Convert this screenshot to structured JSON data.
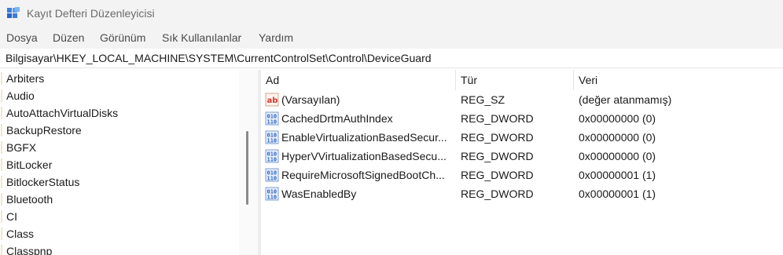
{
  "window": {
    "title": "Kayıt Defteri Düzenleyicisi"
  },
  "menu": [
    "Dosya",
    "Düzen",
    "Görünüm",
    "Sık Kullanılanlar",
    "Yardım"
  ],
  "address": "Bilgisayar\\HKEY_LOCAL_MACHINE\\SYSTEM\\CurrentControlSet\\Control\\DeviceGuard",
  "tree": {
    "items": [
      "Arbiters",
      "Audio",
      "AutoAttachVirtualDisks",
      "BackupRestore",
      "BGFX",
      "BitLocker",
      "BitlockerStatus",
      "Bluetooth",
      "CI",
      "Class",
      "Classpnp"
    ]
  },
  "values": {
    "headers": {
      "name": "Ad",
      "type": "Tür",
      "data": "Veri"
    },
    "rows": [
      {
        "name": "(Varsayılan)",
        "type": "REG_SZ",
        "data": "(değer atanmamış)",
        "icon": "string-value-icon"
      },
      {
        "name": "CachedDrtmAuthIndex",
        "type": "REG_DWORD",
        "data": "0x00000000 (0)",
        "icon": "binary-value-icon"
      },
      {
        "name": "EnableVirtualizationBasedSecur...",
        "type": "REG_DWORD",
        "data": "0x00000000 (0)",
        "icon": "binary-value-icon"
      },
      {
        "name": "HyperVVirtualizationBasedSecu...",
        "type": "REG_DWORD",
        "data": "0x00000000 (0)",
        "icon": "binary-value-icon"
      },
      {
        "name": "RequireMicrosoftSignedBootCh...",
        "type": "REG_DWORD",
        "data": "0x00000001 (1)",
        "icon": "binary-value-icon"
      },
      {
        "name": "WasEnabledBy",
        "type": "REG_DWORD",
        "data": "0x00000001 (1)",
        "icon": "binary-value-icon"
      }
    ]
  },
  "colors": {
    "chrome": "#f3f3f3",
    "icon_blue": "#2b63c6",
    "string_icon_red": "#d0342c"
  }
}
